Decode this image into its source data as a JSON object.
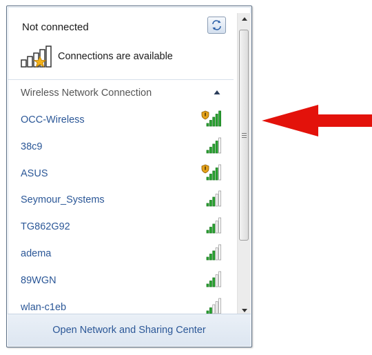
{
  "header": {
    "status": "Not connected",
    "refresh_icon": "refresh-icon",
    "availability": "Connections are available"
  },
  "section": {
    "title": "Wireless Network Connection",
    "collapse_icon": "chevron-up-icon"
  },
  "networks": [
    {
      "name": "OCC-Wireless",
      "signal_bars": 5,
      "secured": false,
      "shield": true
    },
    {
      "name": "38c9",
      "signal_bars": 4
    },
    {
      "name": "ASUS",
      "signal_bars": 4,
      "shield": true
    },
    {
      "name": "Seymour_Systems",
      "signal_bars": 3
    },
    {
      "name": "TG862G92",
      "signal_bars": 3
    },
    {
      "name": "adema",
      "signal_bars": 3
    },
    {
      "name": "89WGN",
      "signal_bars": 3
    },
    {
      "name": "wlan-c1eb",
      "signal_bars": 2
    }
  ],
  "footer": {
    "link": "Open Network and Sharing Center"
  },
  "colors": {
    "link": "#2b5797",
    "arrow": "#e3120b",
    "signal_green": "#2aa632"
  }
}
